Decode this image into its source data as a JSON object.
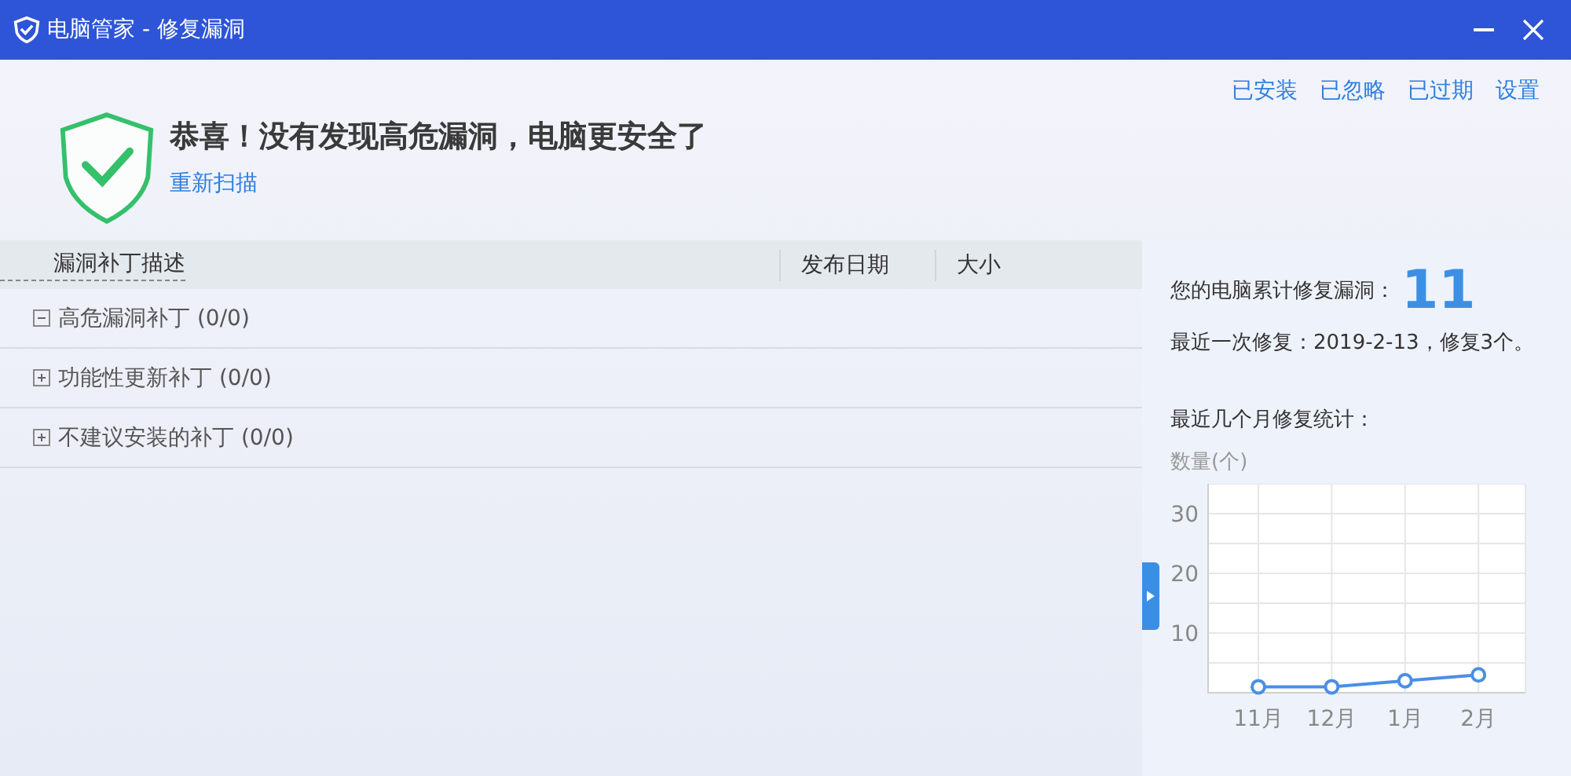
{
  "window": {
    "title": "电脑管家 - 修复漏洞"
  },
  "header_links": [
    "已安装",
    "已忽略",
    "已过期",
    "设置"
  ],
  "status": {
    "message": "恭喜！没有发现高危漏洞，电脑更安全了",
    "rescan_link": "重新扫描"
  },
  "table": {
    "columns": [
      "漏洞补丁描述",
      "发布日期",
      "大小"
    ],
    "groups": [
      {
        "label": "高危漏洞补丁 (0/0)",
        "expanded": true
      },
      {
        "label": "功能性更新补丁 (0/0)",
        "expanded": false
      },
      {
        "label": "不建议安装的补丁 (0/0)",
        "expanded": false
      }
    ]
  },
  "summary": {
    "total_label": "您的电脑累计修复漏洞：",
    "total": "11",
    "last_fix": "最近一次修复：2019-2-13，修复3个。",
    "stats_title": "最近几个月修复统计：",
    "chart_data": {
      "type": "line",
      "ylabel": "数量(个)",
      "categories": [
        "11月",
        "12月",
        "1月",
        "2月"
      ],
      "grid": true,
      "series": [
        {
          "color": "#4a8fe3",
          "marker": "circle",
          "values": [
            1,
            1,
            2,
            3
          ]
        }
      ],
      "ylim": [
        0,
        35
      ],
      "yticks": [
        10,
        20,
        30
      ]
    }
  }
}
